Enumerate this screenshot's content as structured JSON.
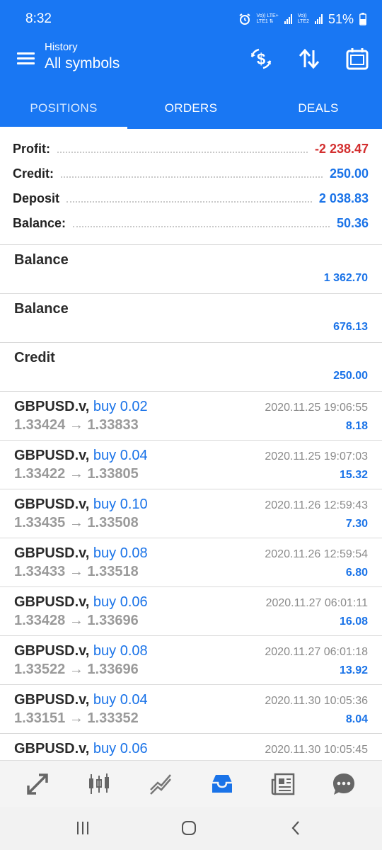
{
  "status": {
    "time": "8:32",
    "net1_top": "Vo)) LTE+",
    "net1_bottom": "LTE1 ⇅",
    "net2_top": "Vo))",
    "net2_bottom": "LTE2",
    "battery": "51%"
  },
  "header": {
    "subtitle": "History",
    "title": "All symbols",
    "actions": [
      "currency-exchange-icon",
      "sort-icon",
      "calendar-icon"
    ]
  },
  "tabs": [
    {
      "label": "POSITIONS",
      "active": true
    },
    {
      "label": "ORDERS",
      "active": false
    },
    {
      "label": "DEALS",
      "active": false
    }
  ],
  "summary": [
    {
      "label": "Profit:",
      "value": "-2 238.47",
      "negative": true
    },
    {
      "label": "Credit:",
      "value": "250.00",
      "negative": false
    },
    {
      "label": "Deposit",
      "value": "2 038.83",
      "negative": false
    },
    {
      "label": "Balance:",
      "value": "50.36",
      "negative": false
    }
  ],
  "operations": [
    {
      "title": "Balance",
      "amount": "1 362.70"
    },
    {
      "title": "Balance",
      "amount": "676.13"
    },
    {
      "title": "Credit",
      "amount": "250.00"
    }
  ],
  "positions": [
    {
      "symbol": "GBPUSD.v,",
      "type": "buy 0.02",
      "prices": "1.33424 → 1.33833",
      "date": "2020.11.25 19:06:55",
      "profit": "8.18"
    },
    {
      "symbol": "GBPUSD.v,",
      "type": "buy 0.04",
      "prices": "1.33422 → 1.33805",
      "date": "2020.11.25 19:07:03",
      "profit": "15.32"
    },
    {
      "symbol": "GBPUSD.v,",
      "type": "buy 0.10",
      "prices": "1.33435 → 1.33508",
      "date": "2020.11.26 12:59:43",
      "profit": "7.30"
    },
    {
      "symbol": "GBPUSD.v,",
      "type": "buy 0.08",
      "prices": "1.33433 → 1.33518",
      "date": "2020.11.26 12:59:54",
      "profit": "6.80"
    },
    {
      "symbol": "GBPUSD.v,",
      "type": "buy 0.06",
      "prices": "1.33428 → 1.33696",
      "date": "2020.11.27 06:01:11",
      "profit": "16.08"
    },
    {
      "symbol": "GBPUSD.v,",
      "type": "buy 0.08",
      "prices": "1.33522 → 1.33696",
      "date": "2020.11.27 06:01:18",
      "profit": "13.92"
    },
    {
      "symbol": "GBPUSD.v,",
      "type": "buy 0.04",
      "prices": "1.33151 → 1.33352",
      "date": "2020.11.30 10:05:36",
      "profit": "8.04"
    },
    {
      "symbol": "GBPUSD.v,",
      "type": "buy 0.06",
      "prices": "",
      "date": "2020.11.30 10:05:45",
      "profit": ""
    }
  ],
  "bottom_nav": [
    {
      "icon": "quotes-icon",
      "active": false
    },
    {
      "icon": "chart-candles-icon",
      "active": false
    },
    {
      "icon": "trade-icon",
      "active": false
    },
    {
      "icon": "history-inbox-icon",
      "active": true
    },
    {
      "icon": "news-icon",
      "active": false
    },
    {
      "icon": "chat-icon",
      "active": false
    }
  ],
  "colors": {
    "header": "#1977f3",
    "accent": "#1a73e8",
    "negative": "#d32f2f"
  }
}
